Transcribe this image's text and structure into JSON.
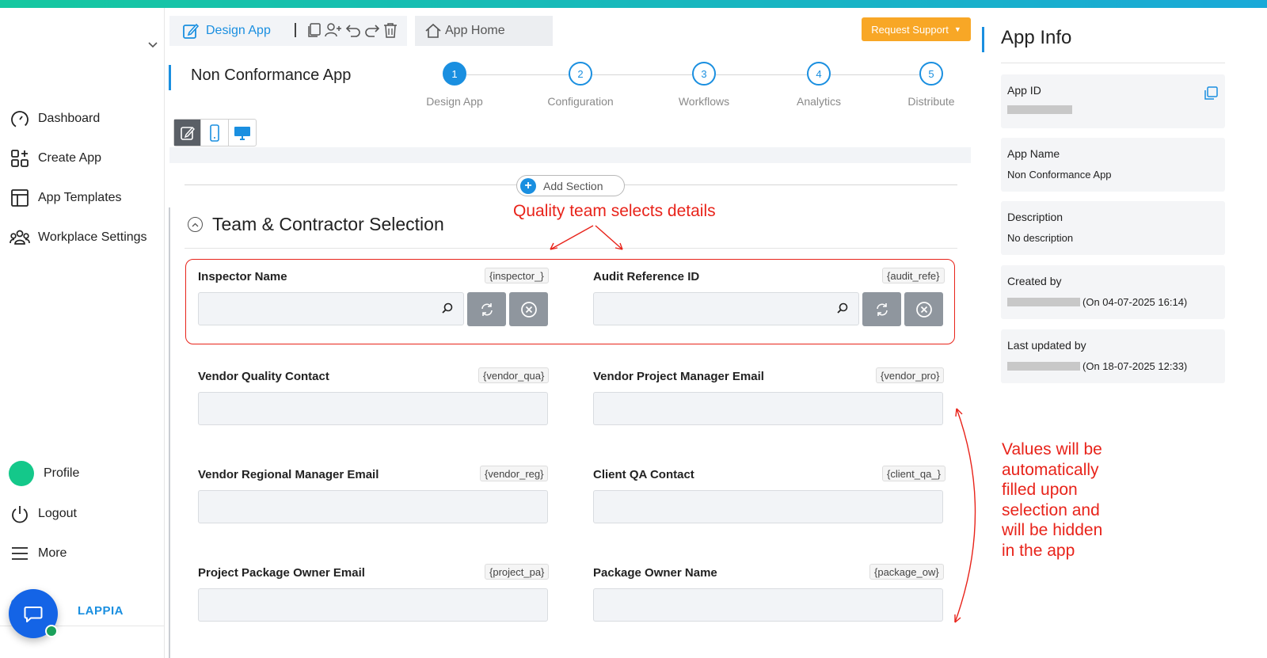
{
  "header": {
    "design_tab": "Design App",
    "home_tab": "App Home",
    "request_support": "Request Support",
    "app_title": "Non Conformance App"
  },
  "sidebar": {
    "items": [
      {
        "label": "Dashboard",
        "icon": "dashboard-icon"
      },
      {
        "label": "Create App",
        "icon": "create-app-icon"
      },
      {
        "label": "App Templates",
        "icon": "templates-icon"
      },
      {
        "label": "Workplace Settings",
        "icon": "workplace-icon"
      }
    ],
    "bottom": [
      {
        "label": "Profile",
        "icon": "profile-avatar"
      },
      {
        "label": "Logout",
        "icon": "power-icon"
      },
      {
        "label": "More",
        "icon": "menu-icon"
      }
    ],
    "logo_text": "LAPPIA"
  },
  "stepper": [
    {
      "num": "1",
      "label": "Design App",
      "active": true
    },
    {
      "num": "2",
      "label": "Configuration",
      "active": false
    },
    {
      "num": "3",
      "label": "Workflows",
      "active": false
    },
    {
      "num": "4",
      "label": "Analytics",
      "active": false
    },
    {
      "num": "5",
      "label": "Distribute",
      "active": false
    }
  ],
  "canvas": {
    "add_section": "Add Section",
    "section_title": "Team & Contractor Selection",
    "fields": [
      {
        "label": "Inspector Name",
        "tag": "{inspector_}"
      },
      {
        "label": "Audit Reference ID",
        "tag": "{audit_refe}"
      },
      {
        "label": "Vendor Quality Contact",
        "tag": "{vendor_qua}"
      },
      {
        "label": "Vendor Project Manager Email",
        "tag": "{vendor_pro}"
      },
      {
        "label": "Vendor Regional Manager Email",
        "tag": "{vendor_reg}"
      },
      {
        "label": "Client QA Contact",
        "tag": "{client_qa_}"
      },
      {
        "label": "Project Package Owner Email",
        "tag": "{project_pa}"
      },
      {
        "label": "Package Owner Name",
        "tag": "{package_ow}"
      }
    ]
  },
  "annotations": {
    "top": "Quality team selects details",
    "side": [
      "Values will be",
      "automatically",
      "filled upon",
      "selection and",
      "will be hidden",
      "in the app"
    ],
    "color": "#e8231a"
  },
  "info": {
    "title": "App Info",
    "app_id_label": "App ID",
    "app_name_label": "App Name",
    "app_name": "Non Conformance App",
    "description_label": "Description",
    "description": "No description",
    "created_by_label": "Created by",
    "created_on": "(On 04-07-2025 16:14)",
    "updated_by_label": "Last updated by",
    "updated_on": "(On 18-07-2025 12:33)"
  },
  "colors": {
    "accent": "#1a8fe0",
    "support": "#f8a726",
    "brand_gradient_start": "#15c8a0",
    "brand_gradient_end": "#1aa9d8"
  }
}
